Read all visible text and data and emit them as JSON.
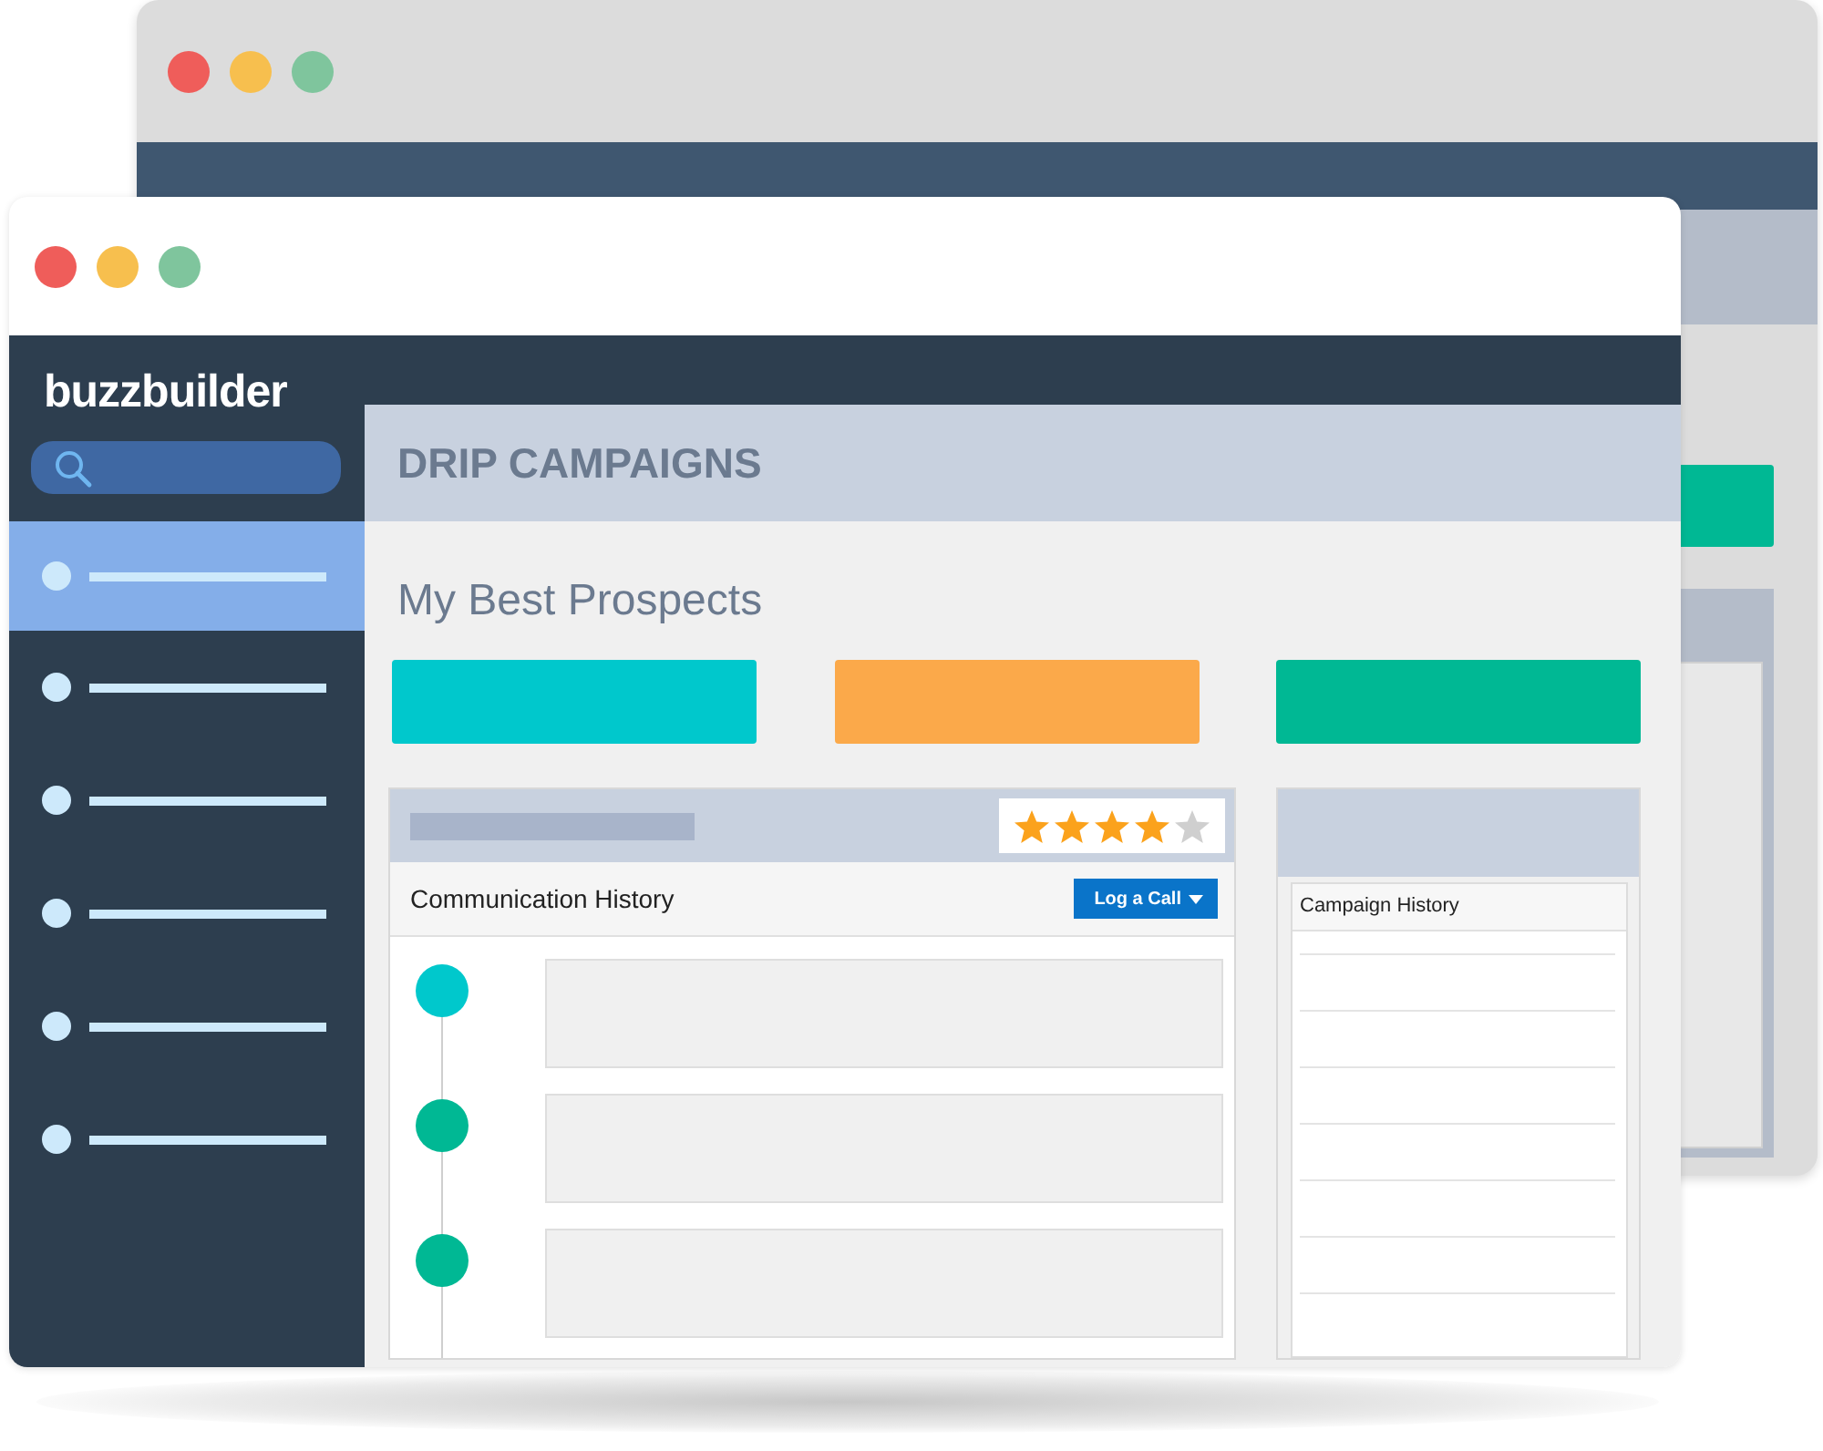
{
  "app": {
    "logo": "buzzbuilder"
  },
  "sidebar": {
    "items": [
      {
        "selected": true
      },
      {
        "selected": false
      },
      {
        "selected": false
      },
      {
        "selected": false
      },
      {
        "selected": false
      },
      {
        "selected": false
      }
    ]
  },
  "header": {
    "title": "DRIP CAMPAIGNS"
  },
  "list_title": "My Best Prospects",
  "tiles": [
    {
      "color": "#00c8cc"
    },
    {
      "color": "#fba94a"
    },
    {
      "color": "#00b894"
    }
  ],
  "prospect_panel": {
    "stars": 4,
    "section_title": "Communication History",
    "log_button": "Log a Call",
    "timeline": [
      {
        "color": "#00c8cc"
      },
      {
        "color": "#00b894"
      },
      {
        "color": "#00b894"
      }
    ]
  },
  "campaign_panel": {
    "title": "Campaign History"
  }
}
